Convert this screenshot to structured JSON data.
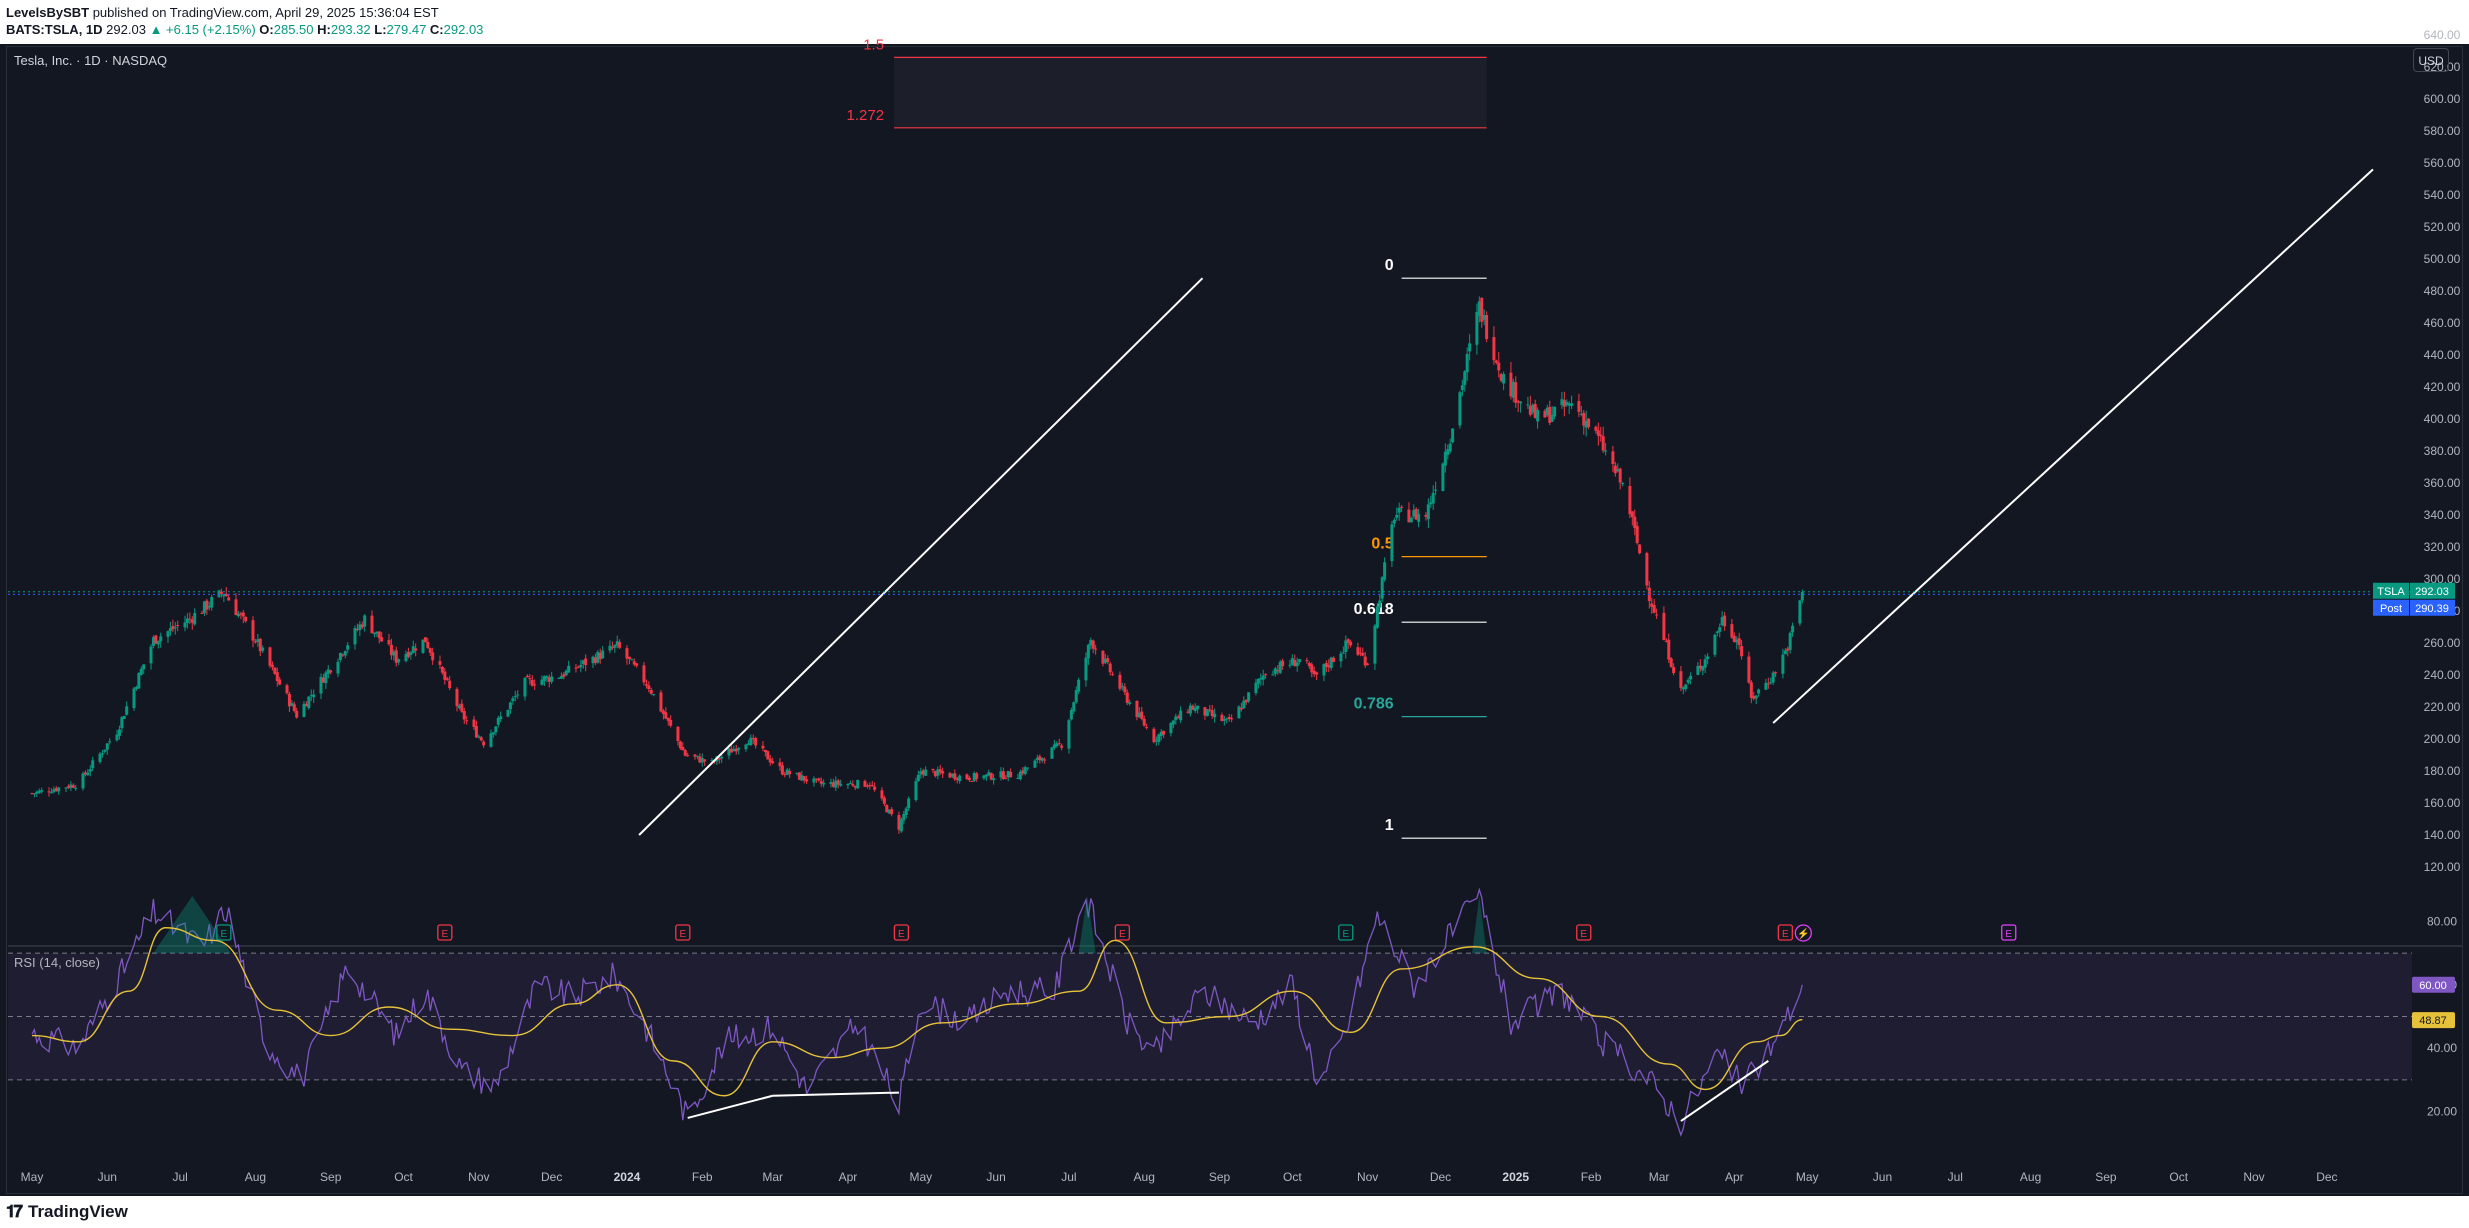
{
  "header": {
    "author": "LevelsBySBT",
    "published": " published on TradingView.com, April 29, 2025 15:36:04 EST",
    "symbol": "BATS:TSLA, 1D",
    "price": "292.03",
    "change": "▲ +6.15 (+2.15%)",
    "o_label": "O:",
    "o": "285.50",
    "h_label": "H:",
    "h": "293.32",
    "l_label": "L:",
    "l": "279.47",
    "c_label": "C:",
    "c": "292.03"
  },
  "chart_title": "Tesla, Inc. · 1D · NASDAQ",
  "currency": "USD",
  "footer": {
    "logo": "TradingView"
  },
  "colors": {
    "background": "#131722",
    "up": "#089981",
    "down": "#f23645",
    "rsi": "#7e57c2",
    "rsi_ma": "#e6c23a",
    "fib_ext": "#f23645",
    "fib_0618": "#ffffff",
    "fib_05": "#ff9800",
    "fib_0786": "#26a69a"
  },
  "chart_data": [
    {
      "type": "candlestick",
      "title": "Tesla, Inc. · 1D · NASDAQ",
      "y_ticks": [
        "640.00",
        "620.00",
        "600.00",
        "580.00",
        "560.00",
        "540.00",
        "520.00",
        "500.00",
        "480.00",
        "460.00",
        "440.00",
        "420.00",
        "400.00",
        "380.00",
        "360.00",
        "340.00",
        "320.00",
        "300.00",
        "280.00",
        "260.00",
        "240.00",
        "220.00",
        "200.00",
        "180.00",
        "160.00",
        "140.00",
        "120.00"
      ],
      "ylim": [
        120,
        650
      ],
      "x_ticks": [
        "May",
        "Jun",
        "Jul",
        "Aug",
        "Sep",
        "Oct",
        "Nov",
        "Dec",
        "2024",
        "Feb",
        "Mar",
        "Apr",
        "May",
        "Jun",
        "Jul",
        "Aug",
        "Sep",
        "Oct",
        "Nov",
        "Dec",
        "2025",
        "Feb",
        "Mar",
        "Apr",
        "May",
        "Jun",
        "Jul",
        "Aug",
        "Sep",
        "Oct",
        "Nov",
        "Dec"
      ],
      "x_range": [
        "2023-05",
        "2025-12"
      ],
      "last_price": {
        "label": "TSLA",
        "value": "292.03"
      },
      "post_price": {
        "label": "Post",
        "value": "290.39"
      },
      "price_path": [
        [
          "2023-05-01",
          166
        ],
        [
          "2023-05-20",
          172
        ],
        [
          "2023-06-05",
          205
        ],
        [
          "2023-06-20",
          262
        ],
        [
          "2023-07-05",
          275
        ],
        [
          "2023-07-19",
          292
        ],
        [
          "2023-08-01",
          262
        ],
        [
          "2023-08-18",
          215
        ],
        [
          "2023-09-01",
          245
        ],
        [
          "2023-09-15",
          275
        ],
        [
          "2023-09-28",
          250
        ],
        [
          "2023-10-10",
          262
        ],
        [
          "2023-10-25",
          215
        ],
        [
          "2023-11-03",
          198
        ],
        [
          "2023-11-20",
          235
        ],
        [
          "2023-12-05",
          240
        ],
        [
          "2023-12-28",
          258
        ],
        [
          "2024-01-10",
          233
        ],
        [
          "2024-01-25",
          190
        ],
        [
          "2024-02-05",
          185
        ],
        [
          "2024-02-20",
          200
        ],
        [
          "2024-03-05",
          180
        ],
        [
          "2024-03-20",
          172
        ],
        [
          "2024-04-10",
          172
        ],
        [
          "2024-04-22",
          145
        ],
        [
          "2024-05-01",
          180
        ],
        [
          "2024-05-20",
          176
        ],
        [
          "2024-06-10",
          178
        ],
        [
          "2024-06-28",
          197
        ],
        [
          "2024-07-10",
          262
        ],
        [
          "2024-07-25",
          225
        ],
        [
          "2024-08-05",
          200
        ],
        [
          "2024-08-20",
          220
        ],
        [
          "2024-09-05",
          210
        ],
        [
          "2024-09-20",
          242
        ],
        [
          "2024-10-05",
          250
        ],
        [
          "2024-10-10",
          238
        ],
        [
          "2024-10-24",
          260
        ],
        [
          "2024-11-01",
          248
        ],
        [
          "2024-11-06",
          290
        ],
        [
          "2024-11-12",
          340
        ],
        [
          "2024-11-25",
          340
        ],
        [
          "2024-12-05",
          390
        ],
        [
          "2024-12-17",
          470
        ],
        [
          "2024-12-27",
          425
        ],
        [
          "2025-01-10",
          400
        ],
        [
          "2025-01-25",
          410
        ],
        [
          "2025-02-05",
          385
        ],
        [
          "2025-02-15",
          355
        ],
        [
          "2025-02-25",
          290
        ],
        [
          "2025-03-10",
          230
        ],
        [
          "2025-03-20",
          250
        ],
        [
          "2025-03-27",
          275
        ],
        [
          "2025-04-03",
          260
        ],
        [
          "2025-04-08",
          225
        ],
        [
          "2025-04-17",
          240
        ],
        [
          "2025-04-23",
          258
        ],
        [
          "2025-04-29",
          292
        ]
      ],
      "earnings_markers": [
        {
          "date": "2023-07-19",
          "label": "E",
          "type": "beat"
        },
        {
          "date": "2023-10-18",
          "label": "E",
          "type": "miss"
        },
        {
          "date": "2024-01-24",
          "label": "E",
          "type": "miss"
        },
        {
          "date": "2024-04-23",
          "label": "E",
          "type": "miss"
        },
        {
          "date": "2024-07-23",
          "label": "E",
          "type": "miss"
        },
        {
          "date": "2024-10-23",
          "label": "E",
          "type": "beat"
        },
        {
          "date": "2025-01-29",
          "label": "E",
          "type": "miss"
        },
        {
          "date": "2025-04-22",
          "label": "E",
          "type": "miss"
        },
        {
          "date": "2025-07-23",
          "label": "E",
          "type": "upcoming"
        }
      ],
      "fibonacci": {
        "levels": [
          {
            "label": "1.5",
            "price": 626,
            "color": "#f23645",
            "from": "2024-04-20",
            "to": "2024-12-20"
          },
          {
            "label": "1.272",
            "price": 582,
            "color": "#f23645",
            "from": "2024-04-20",
            "to": "2024-12-20"
          },
          {
            "label": "0",
            "price": 488,
            "color": "#ffffff",
            "from": "2024-11-15",
            "to": "2024-12-20"
          },
          {
            "label": "0.5",
            "price": 314,
            "color": "#ff9800",
            "from": "2024-11-15",
            "to": "2024-12-20"
          },
          {
            "label": "0.618",
            "price": 273,
            "color": "#ffffff",
            "from": "2024-11-15",
            "to": "2024-12-20"
          },
          {
            "label": "0.786",
            "price": 214,
            "color": "#26a69a",
            "from": "2024-11-15",
            "to": "2024-12-20"
          },
          {
            "label": "1",
            "price": 138,
            "color": "#ffffff",
            "from": "2024-11-15",
            "to": "2024-12-20"
          }
        ]
      },
      "trendlines": [
        {
          "from": [
            "2024-01-06",
            140
          ],
          "to": [
            "2024-08-25",
            488
          ]
        },
        {
          "from": [
            "2025-04-17",
            210
          ],
          "to": [
            "2025-12-20",
            556
          ]
        }
      ]
    },
    {
      "type": "line",
      "title": "RSI (14, close)",
      "y_ticks": [
        "80.00",
        "60.00",
        "40.00",
        "20.00"
      ],
      "ylim": [
        10,
        90
      ],
      "bands": [
        70,
        50,
        30
      ],
      "rsi_value": "60.00",
      "rsi_ma_value": "48.87",
      "series": [
        {
          "key": "rsi",
          "color": "#7e57c2",
          "points": [
            [
              "2023-05-01",
              45
            ],
            [
              "2023-05-20",
              40
            ],
            [
              "2023-06-10",
              68
            ],
            [
              "2023-06-20",
              83
            ],
            [
              "2023-07-10",
              72
            ],
            [
              "2023-07-20",
              84
            ],
            [
              "2023-08-05",
              42
            ],
            [
              "2023-08-20",
              30
            ],
            [
              "2023-09-08",
              66
            ],
            [
              "2023-09-28",
              44
            ],
            [
              "2023-10-10",
              58
            ],
            [
              "2023-10-25",
              33
            ],
            [
              "2023-11-08",
              28
            ],
            [
              "2023-11-25",
              60
            ],
            [
              "2023-12-10",
              56
            ],
            [
              "2023-12-27",
              63
            ],
            [
              "2024-01-10",
              45
            ],
            [
              "2024-01-26",
              18
            ],
            [
              "2024-02-10",
              42
            ],
            [
              "2024-03-01",
              47
            ],
            [
              "2024-03-15",
              27
            ],
            [
              "2024-04-05",
              48
            ],
            [
              "2024-04-22",
              22
            ],
            [
              "2024-05-01",
              55
            ],
            [
              "2024-05-20",
              48
            ],
            [
              "2024-06-05",
              58
            ],
            [
              "2024-06-25",
              58
            ],
            [
              "2024-07-08",
              88
            ],
            [
              "2024-07-25",
              48
            ],
            [
              "2024-08-05",
              38
            ],
            [
              "2024-08-25",
              58
            ],
            [
              "2024-09-15",
              48
            ],
            [
              "2024-10-01",
              60
            ],
            [
              "2024-10-12",
              28
            ],
            [
              "2024-10-23",
              45
            ],
            [
              "2024-11-05",
              82
            ],
            [
              "2024-11-20",
              60
            ],
            [
              "2024-12-17",
              88
            ],
            [
              "2024-12-30",
              48
            ],
            [
              "2025-01-20",
              58
            ],
            [
              "2025-02-05",
              42
            ],
            [
              "2025-02-25",
              30
            ],
            [
              "2025-03-10",
              17
            ],
            [
              "2025-03-25",
              38
            ],
            [
              "2025-04-05",
              28
            ],
            [
              "2025-04-20",
              45
            ],
            [
              "2025-04-29",
              60
            ]
          ]
        },
        {
          "key": "rsi_ma",
          "color": "#e6c23a",
          "points": [
            [
              "2023-05-01",
              44
            ],
            [
              "2023-05-20",
              42
            ],
            [
              "2023-06-10",
              58
            ],
            [
              "2023-06-25",
              78
            ],
            [
              "2023-07-15",
              74
            ],
            [
              "2023-08-10",
              52
            ],
            [
              "2023-09-01",
              44
            ],
            [
              "2023-09-25",
              53
            ],
            [
              "2023-10-20",
              46
            ],
            [
              "2023-11-15",
              44
            ],
            [
              "2023-12-10",
              54
            ],
            [
              "2023-12-28",
              60
            ],
            [
              "2024-01-20",
              36
            ],
            [
              "2024-02-10",
              25
            ],
            [
              "2024-03-01",
              42
            ],
            [
              "2024-03-25",
              37
            ],
            [
              "2024-04-15",
              40
            ],
            [
              "2024-05-10",
              48
            ],
            [
              "2024-06-10",
              54
            ],
            [
              "2024-07-05",
              58
            ],
            [
              "2024-07-20",
              74
            ],
            [
              "2024-08-10",
              48
            ],
            [
              "2024-09-05",
              50
            ],
            [
              "2024-10-01",
              58
            ],
            [
              "2024-10-25",
              45
            ],
            [
              "2024-11-15",
              65
            ],
            [
              "2024-12-15",
              72
            ],
            [
              "2025-01-10",
              62
            ],
            [
              "2025-02-05",
              50
            ],
            [
              "2025-03-05",
              35
            ],
            [
              "2025-03-20",
              27
            ],
            [
              "2025-04-10",
              42
            ],
            [
              "2025-04-20",
              44
            ],
            [
              "2025-04-29",
              49
            ]
          ]
        }
      ],
      "divergence_lines": [
        {
          "from": [
            "2024-01-26",
            18
          ],
          "to": [
            "2024-03-01",
            25
          ]
        },
        {
          "from": [
            "2024-03-01",
            25
          ],
          "to": [
            "2024-04-22",
            26
          ]
        },
        {
          "from": [
            "2025-03-10",
            17
          ],
          "to": [
            "2025-04-15",
            36
          ]
        }
      ]
    }
  ]
}
